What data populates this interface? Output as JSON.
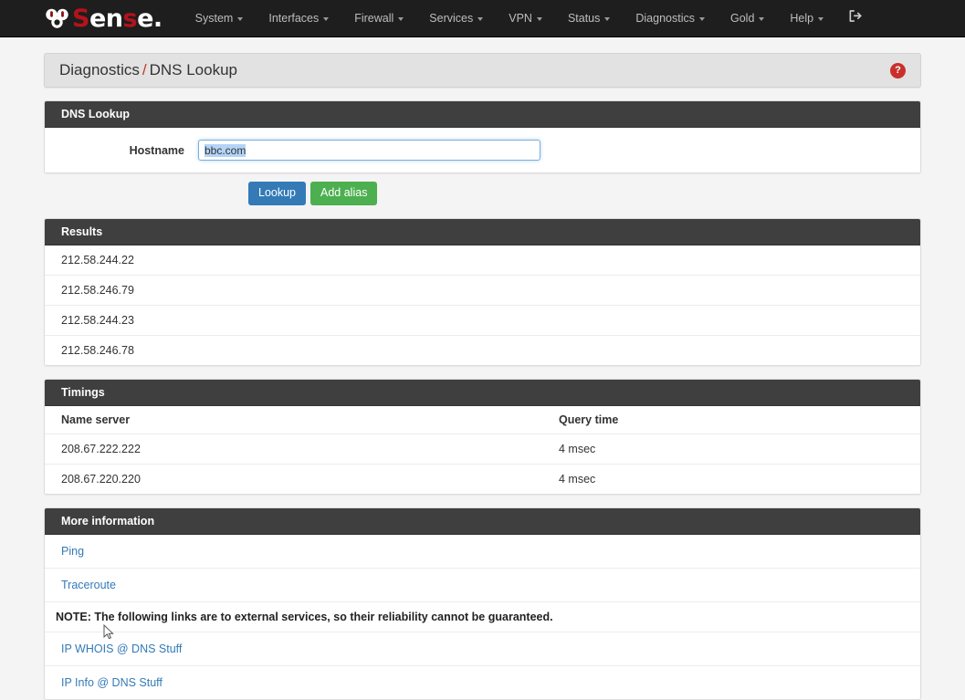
{
  "navbar": {
    "brand": {
      "mark": "pf-logo-icon",
      "text_white_1": "S",
      "text": "ense",
      "full": "pfSense"
    },
    "items": [
      {
        "label": "System",
        "caret": true
      },
      {
        "label": "Interfaces",
        "caret": true
      },
      {
        "label": "Firewall",
        "caret": true
      },
      {
        "label": "Services",
        "caret": true
      },
      {
        "label": "VPN",
        "caret": true
      },
      {
        "label": "Status",
        "caret": true
      },
      {
        "label": "Diagnostics",
        "caret": true
      },
      {
        "label": "Gold",
        "caret": true
      },
      {
        "label": "Help",
        "caret": true
      }
    ],
    "logout_icon": "sign-out-icon"
  },
  "breadcrumb": {
    "parent": "Diagnostics",
    "separator": "/",
    "current": "DNS Lookup",
    "help_icon": "question-mark-icon",
    "help_glyph": "?"
  },
  "dns_lookup_panel": {
    "title": "DNS Lookup",
    "hostname_label": "Hostname",
    "hostname_value": "bbc.com",
    "hostname_placeholder": "",
    "lookup_button": "Lookup",
    "add_alias_button": "Add alias"
  },
  "results_panel": {
    "title": "Results",
    "rows": [
      "212.58.244.22",
      "212.58.246.79",
      "212.58.244.23",
      "212.58.246.78"
    ]
  },
  "timings_panel": {
    "title": "Timings",
    "columns": [
      "Name server",
      "Query time"
    ],
    "rows": [
      {
        "name_server": "208.67.222.222",
        "query_time": "4 msec"
      },
      {
        "name_server": "208.67.220.220",
        "query_time": "4 msec"
      }
    ]
  },
  "more_information_panel": {
    "title": "More information",
    "internal_links": [
      "Ping",
      "Traceroute"
    ],
    "note": "NOTE: The following links are to external services, so their reliability cannot be guaranteed.",
    "external_links": [
      "IP WHOIS @ DNS Stuff",
      "IP Info @ DNS Stuff"
    ]
  },
  "colors": {
    "navbar_bg": "#1e1e1e",
    "panel_heading_bg": "#3f3f3f",
    "brand_red": "#b5121b",
    "link_blue": "#337ab7",
    "primary_button": "#337ab7",
    "success_button": "#4caf50",
    "help_red": "#c9302c",
    "page_bg": "#f4f4f4"
  }
}
